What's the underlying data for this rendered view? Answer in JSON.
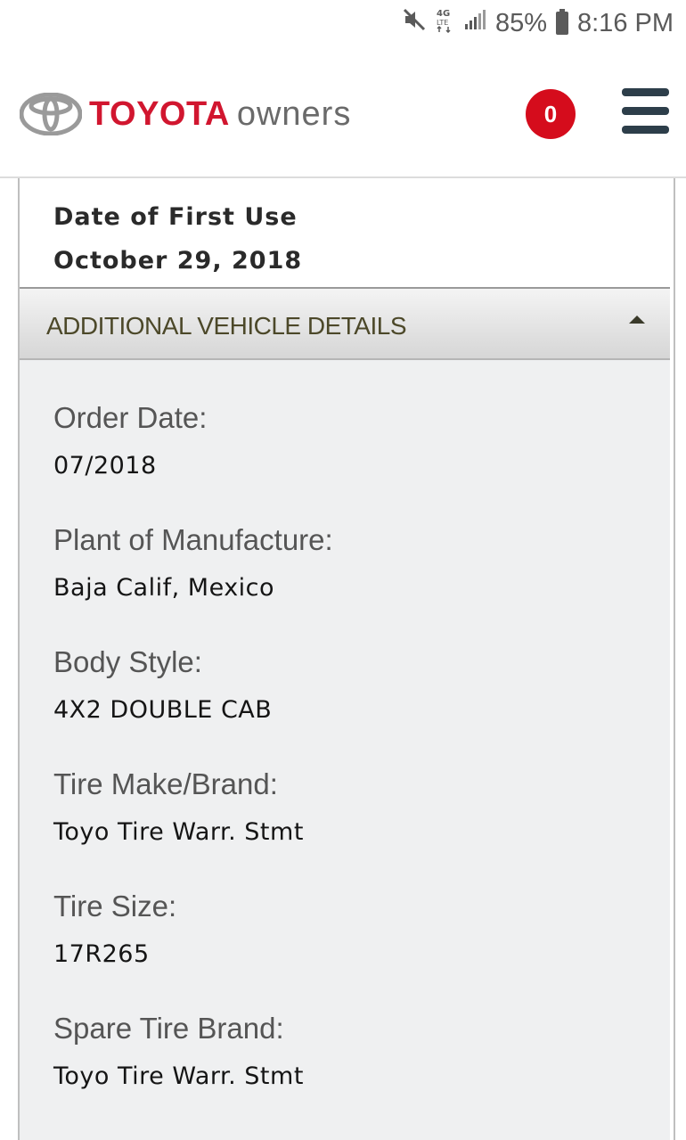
{
  "status_bar": {
    "battery_percent": "85%",
    "time": "8:16 PM",
    "icons": [
      "mute-icon",
      "4g-lte-icon",
      "signal-icon",
      "battery-icon"
    ]
  },
  "header": {
    "logo_brand": "TOYOTA",
    "logo_suffix": "owners",
    "cart_count": "0",
    "brand_color": "#d1162f",
    "badge_color": "#d50c1c",
    "menu_icon": "hamburger-menu-icon"
  },
  "first_use": {
    "label": "Date of First Use",
    "value": "October 29, 2018"
  },
  "additional_details": {
    "title": "ADDITIONAL VEHICLE DETAILS",
    "expanded": true,
    "items": [
      {
        "label": "Order Date:",
        "value": "07/2018"
      },
      {
        "label": "Plant of Manufacture:",
        "value": "Baja Calif, Mexico"
      },
      {
        "label": "Body Style:",
        "value": "4X2 DOUBLE CAB"
      },
      {
        "label": "Tire Make/Brand:",
        "value": "Toyo Tire Warr. Stmt"
      },
      {
        "label": "Tire Size:",
        "value": "17R265"
      },
      {
        "label": "Spare Tire Brand:",
        "value": "Toyo Tire Warr. Stmt"
      }
    ]
  }
}
